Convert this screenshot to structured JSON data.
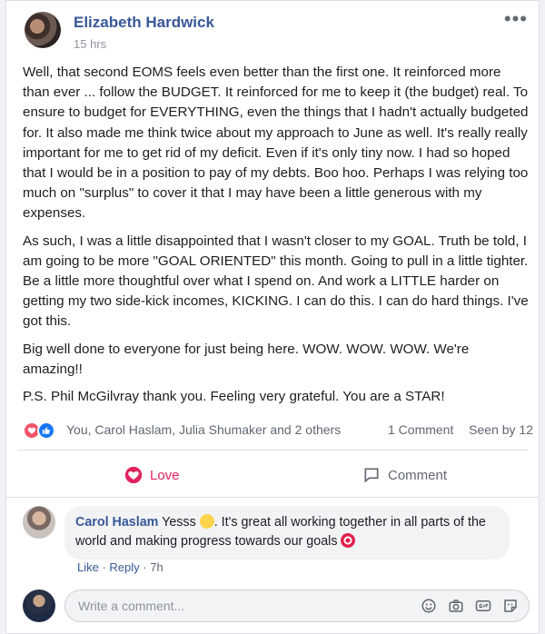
{
  "post": {
    "author": "Elizabeth Hardwick",
    "time": "15 hrs",
    "more_label": "•••",
    "paragraphs": [
      "Well, that second EOMS feels even better than the first one. It reinforced more than ever ... follow the BUDGET. It reinforced for me to keep it (the budget) real. To ensure to budget for EVERYTHING, even the things that I hadn't actually budgeted for. It also made me think twice about my approach to June as well. It's really really important for me to get rid of my deficit. Even if it's only tiny now. I had so hoped that I would be in a position to pay of my debts. Boo hoo. Perhaps I was relying too much on \"surplus\" to cover it that I may have been a little generous with my expenses.",
      "As such, I was a little disappointed that I wasn't closer to my GOAL. Truth be told, I am going to be more \"GOAL ORIENTED\" this month. Going to pull in a little tighter. Be a little more thoughtful over what I spend on. And work a LITTLE harder on getting my two side-kick incomes, KICKING. I can do this. I can do hard things. I've got this.",
      "Big well done to everyone for just being here. WOW. WOW. WOW. We're amazing!!"
    ],
    "ps_prefix": "P.S. ",
    "ps_mention": "Phil McGilvray",
    "ps_suffix": " thank you. Feeling very grateful. You are a STAR!"
  },
  "reactions": {
    "names": "You, Carol Haslam, Julia Shumaker and 2 others",
    "comment_count": "1 Comment",
    "seen_by": "Seen by 12"
  },
  "actions": {
    "love_label": "Love",
    "comment_label": "Comment"
  },
  "comment": {
    "author": "Carol Haslam",
    "text_before_emoji": " Yesss ",
    "text_after_emoji": ". It's great all working together in all parts of the world and making progress towards our goals ",
    "like_label": "Like",
    "reply_label": "Reply",
    "time": "7h"
  },
  "composer": {
    "placeholder": "Write a comment..."
  },
  "icons": [
    "more-icon",
    "love-reaction-icon",
    "like-reaction-icon",
    "heart-icon",
    "comment-icon",
    "smiley-icon",
    "camera-icon",
    "gif-icon",
    "sticker-icon"
  ],
  "colors": {
    "link": "#385898",
    "love": "#e0245e",
    "like": "#1877f2"
  }
}
